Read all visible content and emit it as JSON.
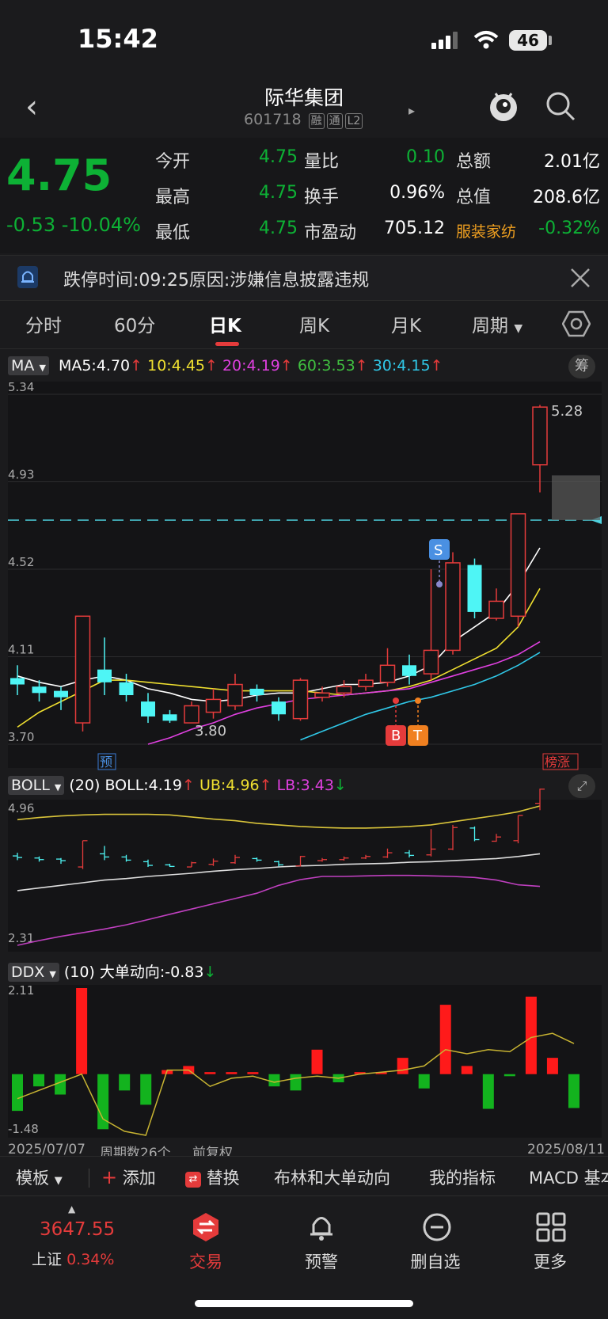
{
  "status": {
    "time": "15:42",
    "battery": "46"
  },
  "nav": {
    "title": "际华集团",
    "code": "601718",
    "tags": [
      "融",
      "通",
      "L2"
    ]
  },
  "quote": {
    "price": "4.75",
    "change": "-0.53",
    "change_pct": "-10.04%",
    "rows": [
      [
        {
          "label": "今开",
          "value": "4.75",
          "color": "green"
        },
        {
          "label": "量比",
          "value": "0.10",
          "color": "green"
        },
        {
          "label": "总额",
          "value": "2.01亿",
          "color": "white"
        }
      ],
      [
        {
          "label": "最高",
          "value": "4.75",
          "color": "green"
        },
        {
          "label": "换手",
          "value": "0.96%",
          "color": "white"
        },
        {
          "label": "总值",
          "value": "208.6亿",
          "color": "white"
        }
      ],
      [
        {
          "label": "最低",
          "value": "4.75",
          "color": "green"
        },
        {
          "label": "市盈动",
          "value": "705.12",
          "color": "white"
        },
        {
          "label": "服装家纺",
          "value": "-0.32%",
          "color": "green"
        }
      ]
    ]
  },
  "notice": {
    "text": "跌停时间:09:25原因:涉嫌信息披露违规"
  },
  "tabs": [
    "分时",
    "60分",
    "日K",
    "周K",
    "月K",
    "周期"
  ],
  "ma": {
    "selector": "MA",
    "items": [
      {
        "label": "MA5:4.70",
        "color": "#ffffff"
      },
      {
        "label": "10:4.45",
        "color": "#f0e030"
      },
      {
        "label": "20:4.19",
        "color": "#e040e0"
      },
      {
        "label": "60:3.53",
        "color": "#40c040"
      },
      {
        "label": "30:4.15",
        "color": "#30c8e8"
      }
    ],
    "right_badge": "筹"
  },
  "chart_data": {
    "type": "candlestick",
    "price_ticks": [
      "5.34",
      "4.93",
      "4.52",
      "4.11",
      "3.70"
    ],
    "ylim": [
      3.7,
      5.34
    ],
    "annotations": {
      "low": "3.80",
      "high": "5.28",
      "pre": "预",
      "rank": "榜涨",
      "buy": "B",
      "t": "T",
      "sell": "S"
    },
    "candles": [
      {
        "o": 4.01,
        "c": 3.98,
        "h": 4.07,
        "l": 3.93
      },
      {
        "o": 3.97,
        "c": 3.94,
        "h": 4.0,
        "l": 3.9
      },
      {
        "o": 3.95,
        "c": 3.92,
        "h": 3.97,
        "l": 3.86
      },
      {
        "o": 3.8,
        "c": 4.3,
        "h": 4.3,
        "l": 3.76
      },
      {
        "o": 4.05,
        "c": 3.99,
        "h": 4.2,
        "l": 3.93
      },
      {
        "o": 3.99,
        "c": 3.93,
        "h": 4.03,
        "l": 3.9
      },
      {
        "o": 3.9,
        "c": 3.83,
        "h": 3.94,
        "l": 3.8
      },
      {
        "o": 3.84,
        "c": 3.81,
        "h": 3.86,
        "l": 3.8
      },
      {
        "o": 3.8,
        "c": 3.88,
        "h": 3.9,
        "l": 3.8
      },
      {
        "o": 3.85,
        "c": 3.91,
        "h": 3.96,
        "l": 3.82
      },
      {
        "o": 3.88,
        "c": 3.98,
        "h": 4.03,
        "l": 3.86
      },
      {
        "o": 3.96,
        "c": 3.93,
        "h": 3.98,
        "l": 3.9
      },
      {
        "o": 3.9,
        "c": 3.84,
        "h": 3.92,
        "l": 3.81
      },
      {
        "o": 3.82,
        "c": 4.0,
        "h": 4.01,
        "l": 3.81
      },
      {
        "o": 3.92,
        "c": 3.94,
        "h": 3.97,
        "l": 3.9
      },
      {
        "o": 3.94,
        "c": 3.97,
        "h": 4.0,
        "l": 3.92
      },
      {
        "o": 3.97,
        "c": 4.0,
        "h": 4.03,
        "l": 3.95
      },
      {
        "o": 3.99,
        "c": 4.07,
        "h": 4.15,
        "l": 3.97
      },
      {
        "o": 4.07,
        "c": 4.02,
        "h": 4.12,
        "l": 3.98
      },
      {
        "o": 4.03,
        "c": 4.14,
        "h": 4.52,
        "l": 4.0
      },
      {
        "o": 4.14,
        "c": 4.55,
        "h": 4.6,
        "l": 4.12
      },
      {
        "o": 4.54,
        "c": 4.32,
        "h": 4.57,
        "l": 4.29
      },
      {
        "o": 4.29,
        "c": 4.37,
        "h": 4.43,
        "l": 4.28
      },
      {
        "o": 4.3,
        "c": 4.78,
        "h": 4.78,
        "l": 4.25
      },
      {
        "o": 5.01,
        "c": 5.28,
        "h": 5.29,
        "l": 4.88
      }
    ],
    "ma_lines": {
      "ma5": [
        4.02,
        3.99,
        3.97,
        4.0,
        4.02,
        4.0,
        3.96,
        3.94,
        3.91,
        3.9,
        3.91,
        3.93,
        3.94,
        3.94,
        3.96,
        3.98,
        3.98,
        3.99,
        4.02,
        4.07,
        4.18,
        4.25,
        4.32,
        4.45,
        4.62
      ],
      "ma10": [
        3.78,
        3.85,
        3.9,
        3.95,
        4.0,
        4.0,
        3.99,
        3.98,
        3.97,
        3.96,
        3.95,
        3.95,
        3.95,
        3.95,
        3.94,
        3.93,
        3.94,
        3.95,
        3.97,
        4.0,
        4.05,
        4.1,
        4.15,
        4.25,
        4.43
      ],
      "ma20": [
        null,
        null,
        null,
        null,
        null,
        null,
        3.7,
        3.73,
        3.77,
        3.8,
        3.84,
        3.87,
        3.89,
        3.91,
        3.92,
        3.93,
        3.94,
        3.95,
        3.96,
        3.99,
        4.02,
        4.05,
        4.08,
        4.12,
        4.18
      ],
      "ma30": [
        null,
        null,
        null,
        null,
        null,
        null,
        null,
        null,
        null,
        null,
        null,
        null,
        null,
        3.72,
        3.76,
        3.8,
        3.84,
        3.87,
        3.9,
        3.92,
        3.95,
        3.98,
        4.02,
        4.07,
        4.13
      ]
    },
    "dashed_level": 4.75,
    "boll": {
      "label": "(20)",
      "items": [
        {
          "label": "BOLL:4.19",
          "color": "#ffffff"
        },
        {
          "label": "UB:4.96",
          "color": "#f0e030"
        },
        {
          "label": "LB:3.43",
          "color": "#e040e0"
        }
      ],
      "ticks": [
        "4.96",
        "2.31"
      ],
      "ylim": [
        2.31,
        4.96
      ],
      "mid": [
        3.35,
        3.4,
        3.45,
        3.5,
        3.55,
        3.58,
        3.62,
        3.65,
        3.68,
        3.72,
        3.75,
        3.77,
        3.8,
        3.82,
        3.83,
        3.85,
        3.86,
        3.87,
        3.89,
        3.9,
        3.92,
        3.94,
        3.96,
        4.0,
        4.05
      ],
      "ub": [
        4.7,
        4.74,
        4.77,
        4.79,
        4.8,
        4.8,
        4.8,
        4.79,
        4.75,
        4.71,
        4.68,
        4.63,
        4.6,
        4.57,
        4.55,
        4.54,
        4.54,
        4.55,
        4.57,
        4.6,
        4.66,
        4.72,
        4.78,
        4.85,
        4.96
      ],
      "lb": [
        2.31,
        2.4,
        2.48,
        2.55,
        2.62,
        2.7,
        2.8,
        2.9,
        3.0,
        3.1,
        3.2,
        3.3,
        3.45,
        3.56,
        3.62,
        3.62,
        3.63,
        3.64,
        3.64,
        3.63,
        3.62,
        3.6,
        3.55,
        3.46,
        3.43
      ]
    },
    "ddx": {
      "label": "(10) 大单动向:-0.83",
      "ticks": [
        "2.11",
        "-1.48"
      ],
      "ylim": [
        -1.48,
        2.11
      ],
      "bars": [
        -0.9,
        -0.3,
        -0.5,
        2.11,
        -1.35,
        -0.4,
        -0.75,
        0.1,
        0.2,
        0.05,
        0.05,
        0.05,
        -0.3,
        -0.4,
        0.6,
        -0.2,
        0.05,
        0.05,
        0.4,
        -0.35,
        1.7,
        0.2,
        -0.85,
        -0.05,
        1.9,
        0.4,
        -0.83
      ],
      "line": [
        -0.6,
        -0.4,
        -0.2,
        0.0,
        -1.1,
        -1.4,
        -1.5,
        0.1,
        0.1,
        -0.3,
        -0.1,
        -0.05,
        -0.2,
        -0.1,
        -0.05,
        -0.1,
        0.0,
        0.05,
        0.1,
        0.2,
        0.6,
        0.5,
        0.6,
        0.55,
        0.9,
        1.0,
        0.75
      ]
    },
    "footer": {
      "start": "2025/07/07",
      "count": "周期数26个",
      "adj": "前复权",
      "end": "2025/08/11"
    }
  },
  "toolbar": [
    "模板",
    "添加",
    "替换",
    "布林和大单动向",
    "我的指标",
    "MACD 基本"
  ],
  "bottom": {
    "index_value": "3647.55",
    "index_name": "上证",
    "index_pct": "0.34%",
    "items": [
      "交易",
      "预警",
      "删自选",
      "更多"
    ]
  }
}
